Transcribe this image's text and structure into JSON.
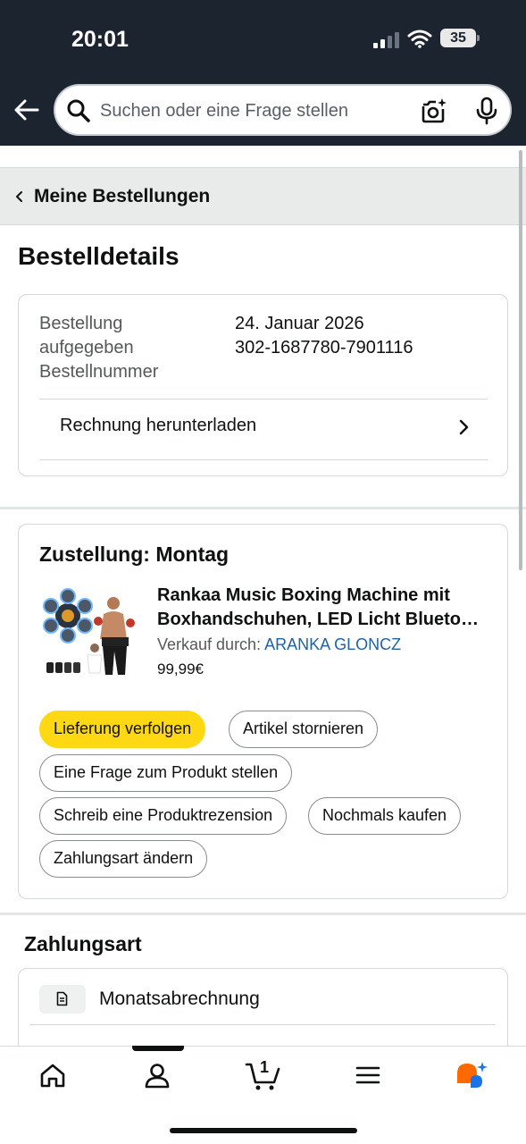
{
  "status_bar": {
    "time": "20:01",
    "battery": "35"
  },
  "search": {
    "placeholder": "Suchen oder eine Frage stellen"
  },
  "breadcrumb": {
    "label": "Meine Bestellungen"
  },
  "page": {
    "title": "Bestelldetails"
  },
  "order_info": {
    "placed_label_line1": "Bestellung",
    "placed_label_line2": "aufgegeben",
    "placed_value": "24. Januar 2026",
    "number_label": "Bestellnummer",
    "number_value": "302-1687780-7901116",
    "invoice_label": "Rechnung herunterladen"
  },
  "delivery": {
    "title": "Zustellung: Montag",
    "product_line1": "Rankaa Music Boxing Machine mit",
    "product_line2": "Boxhandschuhen, LED Licht Bluetooth",
    "seller_prefix": "Verkauf durch:",
    "seller_name": "ARANKA GLONCZ",
    "price": "99,99€",
    "buttons": {
      "track": "Lieferung verfolgen",
      "cancel": "Artikel stornieren",
      "ask": "Eine Frage zum Produkt stellen",
      "review": "Schreib eine Produktrezension",
      "rebuy": "Nochmals kaufen",
      "change_payment": "Zahlungsart ändern"
    }
  },
  "payment": {
    "title": "Zahlungsart",
    "method": "Monatsabrechnung"
  },
  "bottom_nav": {
    "cart_count": "1"
  },
  "colors": {
    "header_bg": "#1c2430",
    "primary_button": "#ffd814",
    "link": "#2162a1",
    "rufus_orange": "#ff6a00",
    "rufus_blue": "#1a73e8"
  },
  "icons": [
    "back-arrow-icon",
    "search-icon",
    "camera-icon",
    "mic-icon",
    "chevron-left-icon",
    "chevron-right-icon",
    "document-icon",
    "home-icon",
    "account-icon",
    "cart-icon",
    "menu-icon",
    "rufus-icon"
  ]
}
